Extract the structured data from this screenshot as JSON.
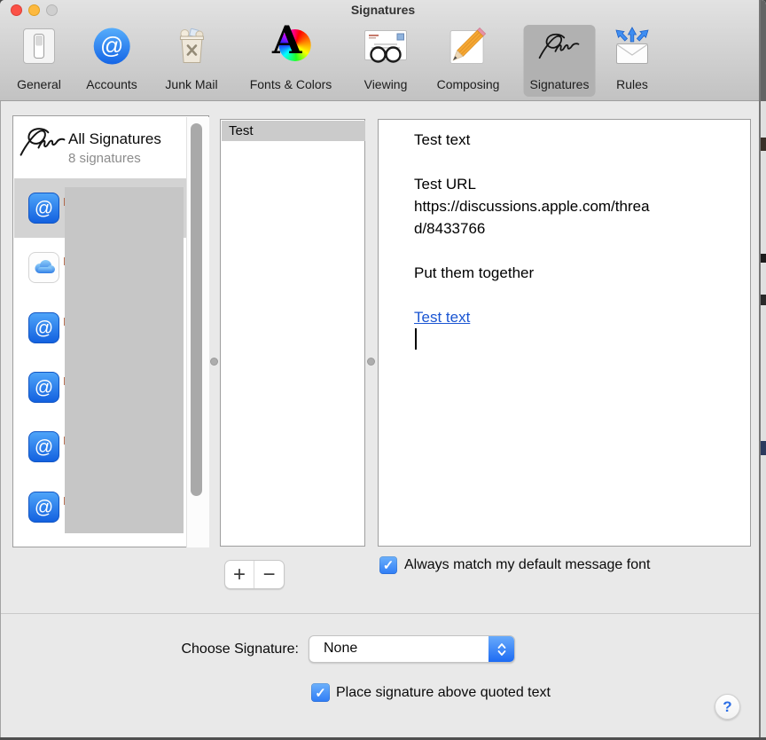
{
  "window": {
    "title": "Signatures"
  },
  "toolbar": {
    "items": [
      {
        "label": "General",
        "icon": "general",
        "selected": false
      },
      {
        "label": "Accounts",
        "icon": "accounts",
        "selected": false
      },
      {
        "label": "Junk Mail",
        "icon": "junk-mail",
        "selected": false
      },
      {
        "label": "Fonts & Colors",
        "icon": "fonts-colors",
        "selected": false
      },
      {
        "label": "Viewing",
        "icon": "viewing",
        "selected": false
      },
      {
        "label": "Composing",
        "icon": "composing",
        "selected": false
      },
      {
        "label": "Signatures",
        "icon": "signatures",
        "selected": true
      },
      {
        "label": "Rules",
        "icon": "rules",
        "selected": false
      }
    ]
  },
  "sidebar": {
    "header": {
      "title": "All Signatures",
      "subtitle": "8 signatures"
    },
    "accounts": [
      {
        "icon": "at-account",
        "selected": true
      },
      {
        "icon": "icloud-account",
        "selected": false
      },
      {
        "icon": "at-account",
        "selected": false
      },
      {
        "icon": "at-account",
        "selected": false
      },
      {
        "icon": "at-account",
        "selected": false
      },
      {
        "icon": "at-account",
        "selected": false
      }
    ]
  },
  "signature_list": {
    "items": [
      {
        "label": "Test",
        "selected": true
      }
    ]
  },
  "editor": {
    "lines": [
      {
        "type": "text",
        "text": "Test text"
      },
      {
        "type": "blank",
        "text": ""
      },
      {
        "type": "text",
        "text": "Test URL"
      },
      {
        "type": "text",
        "text": "https://discussions.apple.com/threa"
      },
      {
        "type": "text",
        "text": "d/8433766"
      },
      {
        "type": "blank",
        "text": ""
      },
      {
        "type": "text",
        "text": "Put them together"
      },
      {
        "type": "blank",
        "text": ""
      },
      {
        "type": "link",
        "text": "Test text"
      },
      {
        "type": "caret",
        "text": ""
      }
    ]
  },
  "controls": {
    "add_label": "+",
    "remove_label": "−",
    "match_font_checkbox": {
      "label": "Always match my default message font",
      "checked": true
    },
    "choose_signature": {
      "label": "Choose Signature:",
      "value": "None"
    },
    "place_above_checkbox": {
      "label": "Place signature above quoted text",
      "checked": true
    },
    "help_label": "?"
  },
  "colors": {
    "accent_blue": "#2e7cf6",
    "link_blue": "#1a55d2",
    "selection_gray": "#d3d3d3",
    "redaction_gray": "#c6c6c6",
    "selected_tab_gray": "#b1b1b1"
  }
}
